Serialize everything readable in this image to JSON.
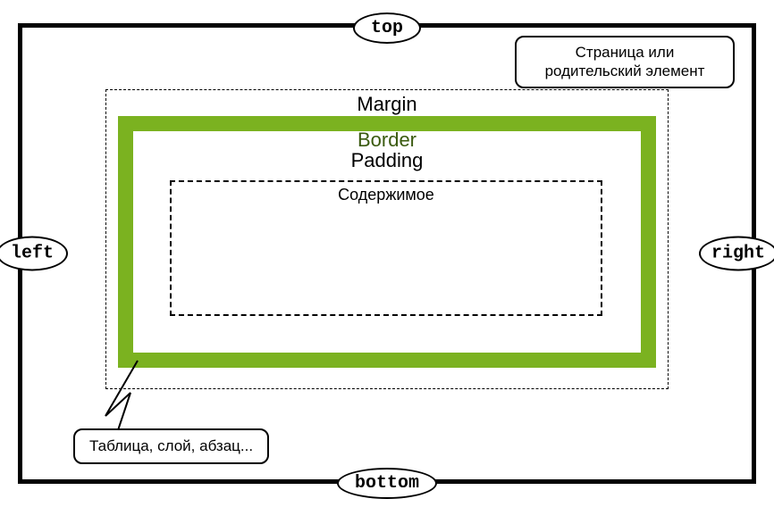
{
  "edges": {
    "top": "top",
    "bottom": "bottom",
    "left": "left",
    "right": "right"
  },
  "box_model": {
    "margin_label": "Margin",
    "border_label": "Border",
    "padding_label": "Padding",
    "content_label": "Содержимое"
  },
  "callouts": {
    "page_or_parent_line1": "Страница или",
    "page_or_parent_line2": "родительский элемент",
    "element_example": "Таблица, слой, абзац..."
  },
  "colors": {
    "border_green": "#7bb220"
  }
}
